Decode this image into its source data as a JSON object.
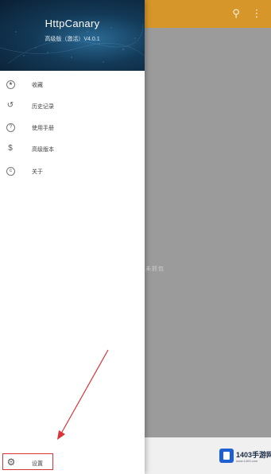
{
  "app": {
    "toolbar_color": "#d7962a",
    "search_icon": "search-icon",
    "more_icon": "more-icon",
    "empty_text": "未抓包"
  },
  "drawer": {
    "header": {
      "title": "HttpCanary",
      "subtitle": "高级版（激活）V4.0.1"
    },
    "items": [
      {
        "icon": "star-icon",
        "label": "收藏"
      },
      {
        "icon": "history-icon",
        "label": "历史记录"
      },
      {
        "icon": "help-icon",
        "label": "使用手册"
      },
      {
        "icon": "dollar-icon",
        "label": "高级版本"
      },
      {
        "icon": "copyright-icon",
        "label": "关于"
      }
    ],
    "settings": {
      "icon": "gear-icon",
      "label": "设置"
    }
  },
  "annotation": {
    "color": "#d9343a"
  },
  "watermark": {
    "text": "1403手游网",
    "sub": "www.1403.com"
  }
}
